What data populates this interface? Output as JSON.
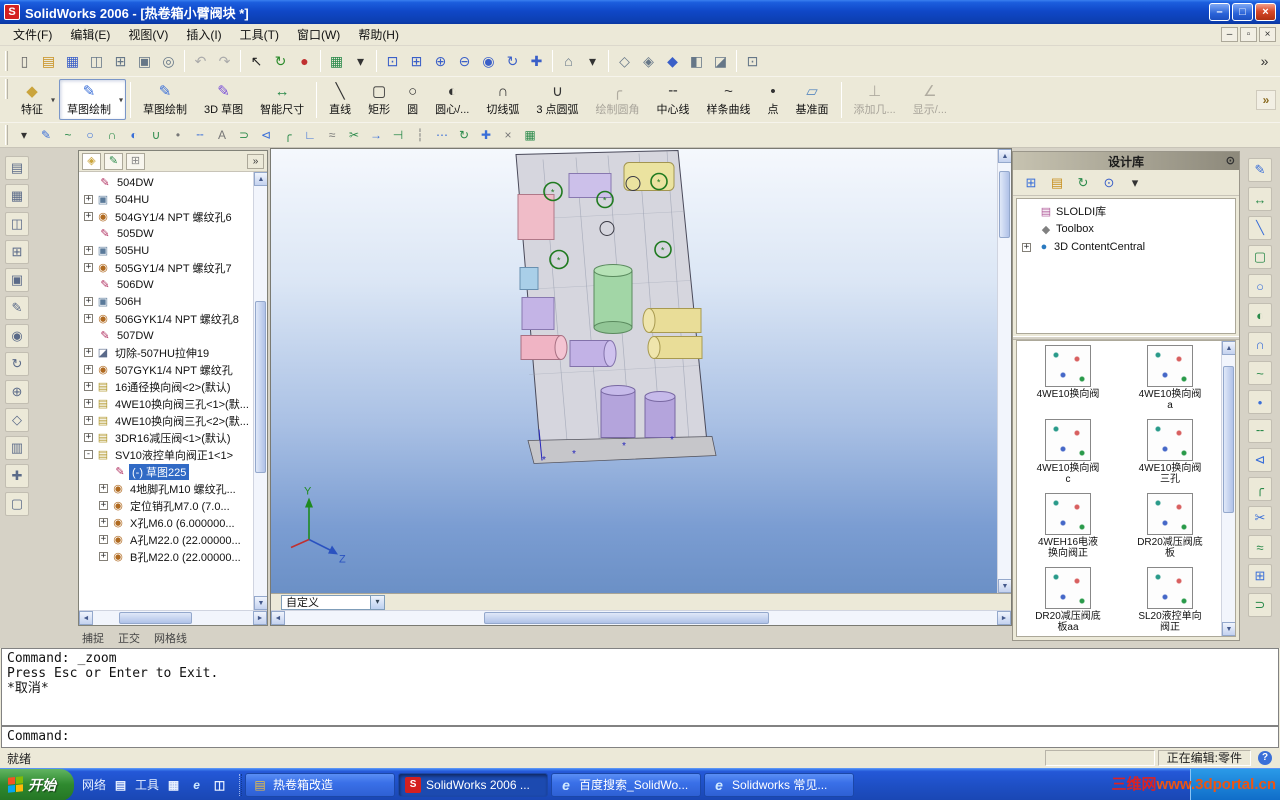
{
  "window": {
    "title": "SolidWorks 2006 - [热卷箱小臂阀块 *]"
  },
  "window_controls": {
    "minimize": "–",
    "maximize": "□",
    "close": "×",
    "mdi_minimize": "–",
    "mdi_restore": "▫",
    "mdi_close": "×"
  },
  "menu": {
    "items": [
      {
        "id": "file",
        "label": "文件(F)"
      },
      {
        "id": "edit",
        "label": "编辑(E)"
      },
      {
        "id": "view",
        "label": "视图(V)"
      },
      {
        "id": "insert",
        "label": "插入(I)"
      },
      {
        "id": "tools",
        "label": "工具(T)"
      },
      {
        "id": "window",
        "label": "窗口(W)"
      },
      {
        "id": "help",
        "label": "帮助(H)"
      }
    ]
  },
  "toolbar_std": {
    "icons": [
      {
        "name": "new-icon",
        "g": "▯",
        "c": "#666666"
      },
      {
        "name": "open-icon",
        "g": "▤",
        "c": "#c89020"
      },
      {
        "name": "save-icon",
        "g": "▦",
        "c": "#3a5fc8"
      },
      {
        "name": "make-drawing-icon",
        "g": "◫",
        "c": "#667788"
      },
      {
        "name": "make-assembly-icon",
        "g": "⊞",
        "c": "#667788"
      },
      {
        "name": "print-icon",
        "g": "▣",
        "c": "#667788"
      },
      {
        "name": "print-preview-icon",
        "g": "◎",
        "c": "#667788"
      },
      {
        "name": "sep"
      },
      {
        "name": "undo-icon",
        "g": "↶",
        "c": "#aaaaaa"
      },
      {
        "name": "redo-icon",
        "g": "↷",
        "c": "#aaaaaa"
      },
      {
        "name": "sep"
      },
      {
        "name": "select-icon",
        "g": "↖",
        "c": "#222222"
      },
      {
        "name": "rebuild-icon",
        "g": "↻",
        "c": "#2a8a2a"
      },
      {
        "name": "edit-color-icon",
        "g": "●",
        "c": "#c03030"
      },
      {
        "name": "sep"
      },
      {
        "name": "grid-icon",
        "g": "▦",
        "c": "#2a8a4a"
      },
      {
        "name": "options-dropdown-icon",
        "g": "▾",
        "c": "#333333"
      },
      {
        "name": "sep"
      },
      {
        "name": "zoom-fit-icon",
        "g": "⊡",
        "c": "#3a5fc8"
      },
      {
        "name": "zoom-area-icon",
        "g": "⊞",
        "c": "#3a5fc8"
      },
      {
        "name": "zoom-in-out-icon",
        "g": "⊕",
        "c": "#3a5fc8"
      },
      {
        "name": "zoom-out-icon",
        "g": "⊖",
        "c": "#3a5fc8"
      },
      {
        "name": "zoom-selection-icon",
        "g": "◉",
        "c": "#3a5fc8"
      },
      {
        "name": "rotate-view-icon",
        "g": "↻",
        "c": "#3a5fc8"
      },
      {
        "name": "pan-icon",
        "g": "✚",
        "c": "#3a5fc8"
      },
      {
        "name": "sep"
      },
      {
        "name": "standard-views-icon",
        "g": "⌂",
        "c": "#667788"
      },
      {
        "name": "view-orientation-icon",
        "g": "▾",
        "c": "#333333"
      },
      {
        "name": "sep"
      },
      {
        "name": "wireframe-icon",
        "g": "◇",
        "c": "#667788"
      },
      {
        "name": "hidden-lines-icon",
        "g": "◈",
        "c": "#667788"
      },
      {
        "name": "shaded-icon",
        "g": "◆",
        "c": "#3a5fc8"
      },
      {
        "name": "shadows-icon",
        "g": "◧",
        "c": "#667788"
      },
      {
        "name": "section-view-icon",
        "g": "◪",
        "c": "#667788"
      },
      {
        "name": "sep"
      },
      {
        "name": "fullscreen-icon",
        "g": "⊡",
        "c": "#667788"
      },
      {
        "name": "overflow-chevron-icon",
        "g": "»",
        "c": "#333333",
        "push": true
      }
    ]
  },
  "toolbar_big": {
    "overflow_glyph": "»",
    "buttons": [
      {
        "id": "features",
        "label": "特征",
        "icon": "◆",
        "color": "#caa43c",
        "state": "normal",
        "dropdown": true
      },
      {
        "id": "sketch",
        "label": "草图绘制",
        "icon": "✎",
        "color": "#3a6fd8",
        "state": "pressed",
        "dropdown": true
      },
      {
        "sep": true
      },
      {
        "id": "sketch-2",
        "label": "草图绘制",
        "icon": "✎",
        "color": "#3a6fd8",
        "state": "normal"
      },
      {
        "id": "3d-sketch",
        "label": "3D 草图",
        "icon": "✎",
        "color": "#7a4fd8",
        "state": "normal"
      },
      {
        "id": "smart-dimension",
        "label": "智能尺寸",
        "icon": "↔",
        "color": "#2a8a4a",
        "state": "normal"
      },
      {
        "sep": true
      },
      {
        "id": "line",
        "label": "直线",
        "icon": "╲",
        "color": "#333333",
        "state": "normal"
      },
      {
        "id": "rectangle",
        "label": "矩形",
        "icon": "▢",
        "color": "#333333",
        "state": "normal"
      },
      {
        "id": "circle",
        "label": "圆",
        "icon": "○",
        "color": "#333333",
        "state": "normal"
      },
      {
        "id": "centerpoint-arc",
        "label": "圆心/...",
        "icon": "◐",
        "color": "#333333",
        "state": "normal"
      },
      {
        "id": "tangent-arc",
        "label": "切线弧",
        "icon": "∩",
        "color": "#333333",
        "state": "normal"
      },
      {
        "id": "3point-arc",
        "label": "3 点圆弧",
        "icon": "∪",
        "color": "#333333",
        "state": "normal"
      },
      {
        "id": "sketch-fillet",
        "label": "绘制圆角",
        "icon": "╭",
        "color": "#333333",
        "state": "disabled"
      },
      {
        "id": "centerline",
        "label": "中心线",
        "icon": "╌",
        "color": "#333333",
        "state": "normal"
      },
      {
        "id": "spline",
        "label": "样条曲线",
        "icon": "~",
        "color": "#333333",
        "state": "normal"
      },
      {
        "id": "point",
        "label": "点",
        "icon": "•",
        "color": "#333333",
        "state": "normal"
      },
      {
        "id": "plane",
        "label": "基准面",
        "icon": "▱",
        "color": "#5a8ac0",
        "state": "normal"
      },
      {
        "sep": true
      },
      {
        "id": "add-relation",
        "label": "添加几...",
        "icon": "⊥",
        "color": "#333333",
        "state": "disabled"
      },
      {
        "id": "display-relations",
        "label": "显示/...",
        "icon": "∠",
        "color": "#333333",
        "state": "disabled"
      }
    ]
  },
  "toolbar_snap": {
    "icons": [
      {
        "name": "snap-dropdown-icon",
        "g": "▾",
        "c": "#333333"
      },
      {
        "name": "sketch-entity-icon",
        "g": "✎",
        "c": "#3a6fd8"
      },
      {
        "name": "spline-tool-icon",
        "g": "~",
        "c": "#2a8a4a"
      },
      {
        "name": "circle-tool-icon",
        "g": "○",
        "c": "#3a6fd8"
      },
      {
        "name": "arc-tool-icon",
        "g": "∩",
        "c": "#2a8a4a"
      },
      {
        "name": "ellipse-tool-icon",
        "g": "◐",
        "c": "#3a6fd8"
      },
      {
        "name": "parabola-tool-icon",
        "g": "∪",
        "c": "#2a8a4a"
      },
      {
        "name": "point-tool-icon",
        "g": "•",
        "c": "#777777"
      },
      {
        "name": "centerline-tool-icon",
        "g": "╌",
        "c": "#3a6fd8"
      },
      {
        "name": "text-tool-icon",
        "g": "A",
        "c": "#777777"
      },
      {
        "name": "convert-entities-icon",
        "g": "⊃",
        "c": "#2a8a4a"
      },
      {
        "name": "mirror-entities-icon",
        "g": "⊲",
        "c": "#3a6fd8"
      },
      {
        "name": "fillet-tool-icon",
        "g": "╭",
        "c": "#2a8a4a"
      },
      {
        "name": "chamfer-tool-icon",
        "g": "∟",
        "c": "#3a6fd8"
      },
      {
        "name": "offset-entities-icon",
        "g": "≈",
        "c": "#777777"
      },
      {
        "name": "trim-entities-icon",
        "g": "✂",
        "c": "#2a8a4a"
      },
      {
        "name": "extend-entities-icon",
        "g": "→",
        "c": "#3a6fd8"
      },
      {
        "name": "split-entities-icon",
        "g": "⊣",
        "c": "#2a8a4a"
      },
      {
        "name": "construction-geometry-icon",
        "g": "┆",
        "c": "#777777"
      },
      {
        "name": "linear-pattern-icon",
        "g": "⋯",
        "c": "#3a6fd8"
      },
      {
        "name": "circular-pattern-icon",
        "g": "↻",
        "c": "#2a8a4a"
      },
      {
        "name": "modify-sketch-icon",
        "g": "✚",
        "c": "#3a6fd8"
      },
      {
        "name": "close-sketch-icon",
        "g": "×",
        "c": "#777777"
      },
      {
        "name": "sketch-picture-icon",
        "g": "▦",
        "c": "#2a8a4a"
      }
    ]
  },
  "left_strip": {
    "icons": [
      {
        "name": "filter-toggle-icon",
        "g": "▤",
        "c": "#5a6a88"
      },
      {
        "name": "clear-filters-icon",
        "g": "▦",
        "c": "#5a6a88"
      },
      {
        "name": "filter-vertices-icon",
        "g": "◫",
        "c": "#5a6a88"
      },
      {
        "name": "filter-edges-icon",
        "g": "⊞",
        "c": "#5a6a88"
      },
      {
        "name": "filter-faces-icon",
        "g": "▣",
        "c": "#5a6a88"
      },
      {
        "name": "filter-surface-icon",
        "g": "✎",
        "c": "#5a6a88"
      },
      {
        "name": "filter-solid-icon",
        "g": "◉",
        "c": "#5a6a88"
      },
      {
        "name": "filter-axes-icon",
        "g": "↻",
        "c": "#5a6a88"
      },
      {
        "name": "filter-planes-icon",
        "g": "⊕",
        "c": "#5a6a88"
      },
      {
        "name": "filter-sketch-points-icon",
        "g": "◇",
        "c": "#5a6a88"
      },
      {
        "name": "filter-sketch-segments-icon",
        "g": "▥",
        "c": "#5a6a88"
      },
      {
        "name": "filter-midpoints-icon",
        "g": "✚",
        "c": "#5a6a88"
      },
      {
        "name": "filter-dimensions-icon",
        "g": "▢",
        "c": "#5a6a88"
      }
    ]
  },
  "right_strip": {
    "icons": [
      {
        "name": "sketch-icon",
        "g": "✎",
        "c": "#3a6fd8"
      },
      {
        "name": "smart-dimension-icon",
        "g": "↔",
        "c": "#2a8a4a"
      },
      {
        "name": "line-icon",
        "g": "╲",
        "c": "#3a6fd8"
      },
      {
        "name": "rectangle-icon",
        "g": "▢",
        "c": "#2a8a4a"
      },
      {
        "name": "circle-icon",
        "g": "○",
        "c": "#3a6fd8"
      },
      {
        "name": "centerpoint-arc-icon",
        "g": "◐",
        "c": "#2a8a4a"
      },
      {
        "name": "tangent-ar-icon",
        "g": "∩",
        "c": "#3a6fd8"
      },
      {
        "name": "spline-icon",
        "g": "~",
        "c": "#2a8a4a"
      },
      {
        "name": "point-icon",
        "g": "•",
        "c": "#3a6fd8"
      },
      {
        "name": "centerline-icon",
        "g": "╌",
        "c": "#2a8a4a"
      },
      {
        "name": "mirror-icon",
        "g": "⊲",
        "c": "#3a6fd8"
      },
      {
        "name": "fillet-icon",
        "g": "╭",
        "c": "#2a8a4a"
      },
      {
        "name": "trim-icon",
        "g": "✂",
        "c": "#3a6fd8"
      },
      {
        "name": "offset-icon",
        "g": "≈",
        "c": "#2a8a4a"
      },
      {
        "name": "pattern-icon",
        "g": "⊞",
        "c": "#3a6fd8"
      },
      {
        "name": "convert-entities-icon",
        "g": "⊃",
        "c": "#2a8a4a"
      }
    ]
  },
  "feature_tree": {
    "tabs": [
      {
        "name": "featuremanager-tab",
        "g": "◈",
        "c": "#caa43c"
      },
      {
        "name": "propertymanager-tab",
        "g": "✎",
        "c": "#2a8a4a"
      },
      {
        "name": "configurationmanager-tab",
        "g": "⊞",
        "c": "#888888"
      }
    ],
    "chevron": "»",
    "icon_map": {
      "sketch": {
        "g": "✎",
        "c": "#b03060"
      },
      "feature": {
        "g": "▣",
        "c": "#5a7a9a"
      },
      "hole": {
        "g": "◉",
        "c": "#b06a20"
      },
      "cut": {
        "g": "◪",
        "c": "#5a6a8a"
      },
      "part": {
        "g": "▤",
        "c": "#b0962a"
      }
    },
    "items": [
      {
        "label": "504DW",
        "expand": "",
        "icon": "sketch",
        "indent": 1
      },
      {
        "label": "504HU",
        "expand": "+",
        "icon": "feature",
        "indent": 1
      },
      {
        "label": "504GY1/4 NPT 螺纹孔6",
        "expand": "+",
        "icon": "hole",
        "indent": 1
      },
      {
        "label": "505DW",
        "expand": "",
        "icon": "sketch",
        "indent": 1
      },
      {
        "label": "505HU",
        "expand": "+",
        "icon": "feature",
        "indent": 1
      },
      {
        "label": "505GY1/4 NPT 螺纹孔7",
        "expand": "+",
        "icon": "hole",
        "indent": 1
      },
      {
        "label": "506DW",
        "expand": "",
        "icon": "sketch",
        "indent": 1
      },
      {
        "label": "506H",
        "expand": "+",
        "icon": "feature",
        "indent": 1
      },
      {
        "label": "506GYK1/4 NPT 螺纹孔8",
        "expand": "+",
        "icon": "hole",
        "indent": 1
      },
      {
        "label": "507DW",
        "expand": "",
        "icon": "sketch",
        "indent": 1
      },
      {
        "label": "切除-507HU拉伸19",
        "expand": "+",
        "icon": "cut",
        "indent": 1
      },
      {
        "label": "507GYK1/4 NPT 螺纹孔",
        "expand": "+",
        "icon": "hole",
        "indent": 1
      },
      {
        "label": "16通径换向阀<2>(默认)",
        "expand": "+",
        "icon": "part",
        "indent": 1
      },
      {
        "label": "4WE10换向阀三孔<1>(默...",
        "expand": "+",
        "icon": "part",
        "indent": 1
      },
      {
        "label": "4WE10换向阀三孔<2>(默...",
        "expand": "+",
        "icon": "part",
        "indent": 1
      },
      {
        "label": "3DR16减压阀<1>(默认)",
        "expand": "+",
        "icon": "part",
        "indent": 1
      },
      {
        "label": "SV10液控单向阀正1<1>",
        "expand": "-",
        "icon": "part",
        "indent": 1
      },
      {
        "label": "(-) 草图225",
        "expand": "",
        "icon": "sketch",
        "indent": 2,
        "selected": true
      },
      {
        "label": "4地脚孔M10 螺纹孔...",
        "expand": "+",
        "icon": "hole",
        "indent": 2
      },
      {
        "label": "定位销孔M7.0 (7.0...",
        "expand": "+",
        "icon": "hole",
        "indent": 2
      },
      {
        "label": "X孔M6.0 (6.000000...",
        "expand": "+",
        "icon": "hole",
        "indent": 2
      },
      {
        "label": "A孔M22.0 (22.00000...",
        "expand": "+",
        "icon": "hole",
        "indent": 2
      },
      {
        "label": "B孔M22.0 (22.00000...",
        "expand": "+",
        "icon": "hole",
        "indent": 2
      }
    ]
  },
  "tree_footer": {
    "items": [
      "捕捉",
      "正交",
      "网格线"
    ]
  },
  "viewport": {
    "combo_value": "自定义",
    "axis_y": "Y",
    "axis_z": "Z"
  },
  "design_library": {
    "title": "设计库",
    "pin_glyph": "⊙",
    "toolbar": [
      {
        "name": "add-to-library-icon",
        "g": "⊞",
        "c": "#3a6fd8"
      },
      {
        "name": "new-folder-icon",
        "g": "▤",
        "c": "#c89020"
      },
      {
        "name": "refresh-icon",
        "g": "↻",
        "c": "#2a8a4a"
      },
      {
        "name": "search-icon",
        "g": "⊙",
        "c": "#3a5fc8"
      },
      {
        "name": "search-dropdown-icon",
        "g": "▾",
        "c": "#333333"
      }
    ],
    "tree": [
      {
        "id": "sloldi",
        "label": "SLOLDI库",
        "g": "▤",
        "c": "#b05a9a",
        "expand": ""
      },
      {
        "id": "toolbox",
        "label": "Toolbox",
        "g": "◆",
        "c": "#808080",
        "expand": ""
      },
      {
        "id": "contentcentral",
        "label": "3D ContentCentral",
        "g": "●",
        "c": "#2a7ac0",
        "expand": "+"
      }
    ],
    "items": [
      "4WE10换向阀",
      "4WE10换向阀a",
      "4WE10换向阀c",
      "4WE10换向阀三孔",
      "4WEH16电液换向阀正",
      "DR20减压阀底板",
      "DR20减压阀底板aa",
      "SL20液控单向阀正"
    ]
  },
  "console": {
    "history": [
      "Command: _zoom",
      "Press Esc or Enter to Exit.",
      "*取消*"
    ],
    "prompt": "Command:"
  },
  "statusbar": {
    "ready": "就绪",
    "editing": "正在编辑:零件",
    "help_glyph": "?"
  },
  "taskbar": {
    "start_label": "开始",
    "quick": [
      {
        "type": "label",
        "text": "网络"
      },
      {
        "type": "icon",
        "name": "network-places-icon",
        "g": "▤"
      },
      {
        "type": "label",
        "text": "工具"
      },
      {
        "type": "icon",
        "name": "tools-folder-icon",
        "g": "▦"
      },
      {
        "type": "icon",
        "name": "ie-icon",
        "g": "e"
      },
      {
        "type": "icon",
        "name": "show-desktop-icon",
        "g": "◫"
      }
    ],
    "task_icon_map": {
      "folder": "▤",
      "solidworks": "S",
      "ie": "e"
    },
    "tasks": [
      {
        "label": "热卷箱改造",
        "icon": "folder",
        "active": false
      },
      {
        "label": "SolidWorks 2006 ...",
        "icon": "solidworks",
        "active": true
      },
      {
        "label": "百度搜索_SolidWo...",
        "icon": "ie",
        "active": false
      },
      {
        "label": "Solidworks 常见...",
        "icon": "ie",
        "active": false
      }
    ]
  },
  "watermark": {
    "text1": "三维网",
    "text2": "www.3dportal.cn"
  }
}
